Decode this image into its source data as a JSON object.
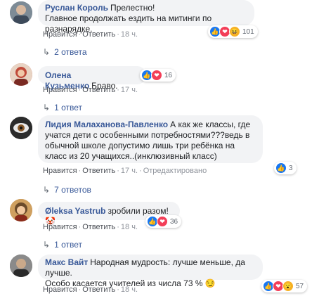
{
  "actions": {
    "like": "Нравится",
    "reply": "Ответить",
    "dot": "·"
  },
  "comments": [
    {
      "author": "Руслан Король",
      "text": "Прелестно!\nГлавное продолжать ездить на митинги по разнарядке.",
      "time": "18 ч.",
      "reactions": [
        "like",
        "love",
        "haha"
      ],
      "reaction_count": "101",
      "replies": "2 ответа",
      "avatar_color": "#6a7a8a"
    },
    {
      "author": "Олена Кузьменко",
      "text": "Браво.",
      "time": "17 ч.",
      "reactions": [
        "like",
        "love"
      ],
      "reaction_count": "16",
      "replies": "1 ответ",
      "avatar_color": "#c0392b"
    },
    {
      "author": "Лидия Малаханова-Павленко",
      "text": "А как же классы, где учатся дети с особенными потребностями???ведь в обычной школе допустимо лишь три ребёнка на класс из 20 учащихся..(инклюзивный класс)",
      "time": "17 ч.",
      "edited": "Отредактировано",
      "reactions": [
        "like"
      ],
      "reaction_count": "3",
      "replies": "7 ответов",
      "avatar_color": "#3b3b3b"
    },
    {
      "author": "Øleksa Yastrub",
      "text": "зробили разом!",
      "time": "18 ч.",
      "reactions": [
        "like",
        "love"
      ],
      "reaction_count": "36",
      "replies": "1 ответ",
      "avatar_color": "#b9863f"
    },
    {
      "author": "Макс Вайт",
      "text": "Народная мудрость: лучше меньше, да лучше.\nОсобо касается учителей из числа 73 %",
      "time": "18 ч.",
      "reactions": [
        "like",
        "love",
        "wow"
      ],
      "reaction_count": "57",
      "avatar_color": "#5a5a5a"
    }
  ],
  "icons": {
    "like": "👍",
    "love": "❤",
    "haha": "😆",
    "wow": "😮",
    "reply_arrow": "↳",
    "smile": "😏",
    "clown": "🤡"
  }
}
